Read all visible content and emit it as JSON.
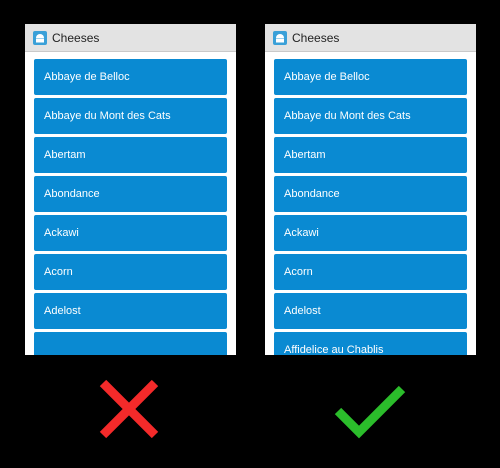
{
  "app": {
    "title": "Cheeses",
    "icon": "android-robot-icon"
  },
  "cheeses": [
    "Abbaye de Belloc",
    "Abbaye du Mont des Cats",
    "Abertam",
    "Abondance",
    "Ackawi",
    "Acorn",
    "Adelost",
    "Affidelice au Chablis"
  ],
  "colors": {
    "list_item": "#0a8ad2",
    "wrong": "#f42a2a",
    "correct": "#2bbd2b"
  },
  "marks": {
    "left": "cross-icon",
    "right": "checkmark-icon"
  }
}
